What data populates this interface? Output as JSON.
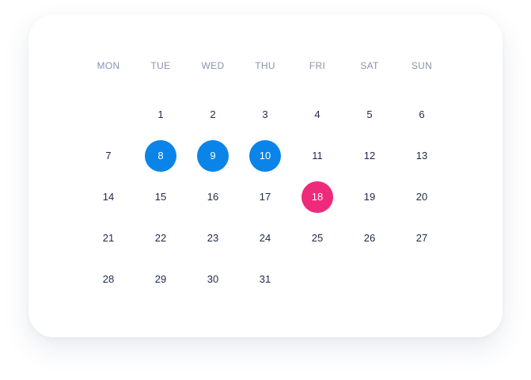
{
  "calendar": {
    "weekdays": [
      "MON",
      "TUE",
      "WED",
      "THU",
      "FRI",
      "SAT",
      "SUN"
    ],
    "days": {
      "d1": "1",
      "d2": "2",
      "d3": "3",
      "d4": "4",
      "d5": "5",
      "d6": "6",
      "d7": "7",
      "d8": "8",
      "d9": "9",
      "d10": "10",
      "d11": "11",
      "d12": "12",
      "d13": "13",
      "d14": "14",
      "d15": "15",
      "d16": "16",
      "d17": "17",
      "d18": "18",
      "d19": "19",
      "d20": "20",
      "d21": "21",
      "d22": "22",
      "d23": "23",
      "d24": "24",
      "d25": "25",
      "d26": "26",
      "d27": "27",
      "d28": "28",
      "d29": "29",
      "d30": "30",
      "d31": "31"
    },
    "selected_days": [
      "8",
      "9",
      "10"
    ],
    "highlighted_day": "18",
    "colors": {
      "selected": "#0a84e8",
      "highlighted": "#ee2a7b",
      "day_text": "#1f2a4a",
      "weekday_text": "#8a94ad"
    }
  }
}
